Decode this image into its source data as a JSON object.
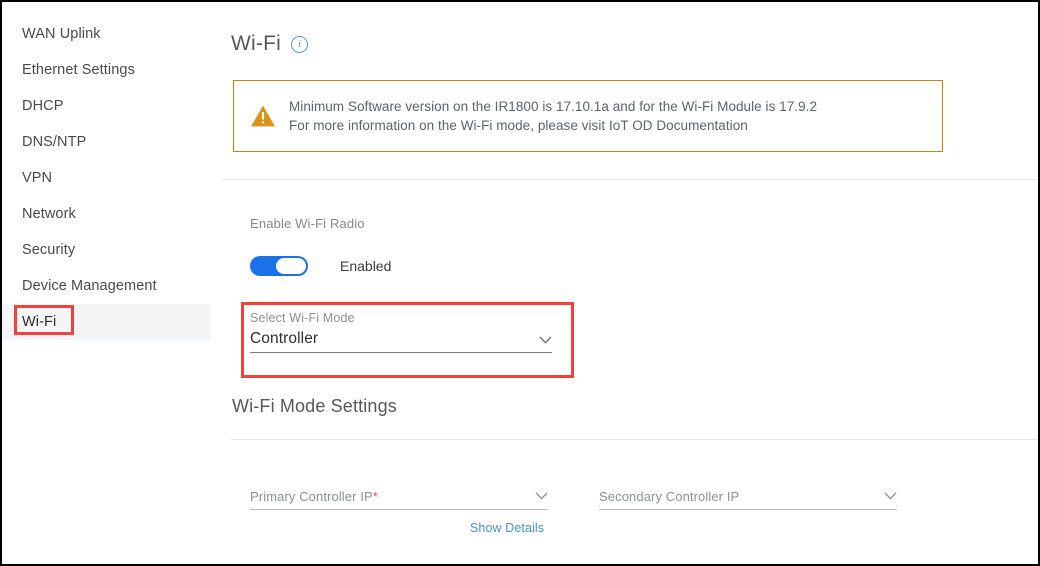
{
  "sidebar": {
    "items": [
      {
        "label": "WAN Uplink",
        "selected": false
      },
      {
        "label": "Ethernet Settings",
        "selected": false
      },
      {
        "label": "DHCP",
        "selected": false
      },
      {
        "label": "DNS/NTP",
        "selected": false
      },
      {
        "label": "VPN",
        "selected": false
      },
      {
        "label": "Network",
        "selected": false
      },
      {
        "label": "Security",
        "selected": false
      },
      {
        "label": "Device Management",
        "selected": false
      },
      {
        "label": "Wi-Fi",
        "selected": true
      }
    ]
  },
  "main": {
    "title": "Wi-Fi",
    "info_icon": "info-icon",
    "warning": {
      "icon": "warning-triangle-icon",
      "line1": "Minimum Software version on the IR1800 is 17.10.1a and for the Wi-Fi Module is 17.9.2",
      "line2": "For more information on the Wi-Fi mode, please visit IoT OD Documentation",
      "border_color": "#bf8d12",
      "icon_color": "#d99316"
    },
    "radio": {
      "label": "Enable Wi-Fi Radio",
      "state_label": "Enabled",
      "enabled": true,
      "accent_color": "#1b72e8"
    },
    "mode_select": {
      "caption": "Select Wi-Fi Mode",
      "value": "Controller",
      "chevron_icon": "chevron-down-icon",
      "highlight_color": "#f6413a"
    },
    "settings_section": {
      "heading": "Wi-Fi Mode Settings",
      "primary_ip": {
        "label": "Primary Controller IP",
        "required_marker": "*",
        "value": "",
        "chevron_icon": "chevron-down-icon"
      },
      "secondary_ip": {
        "label": "Secondary Controller IP",
        "required_marker": "",
        "value": "",
        "chevron_icon": "chevron-down-icon"
      },
      "show_details_label": "Show Details"
    }
  }
}
